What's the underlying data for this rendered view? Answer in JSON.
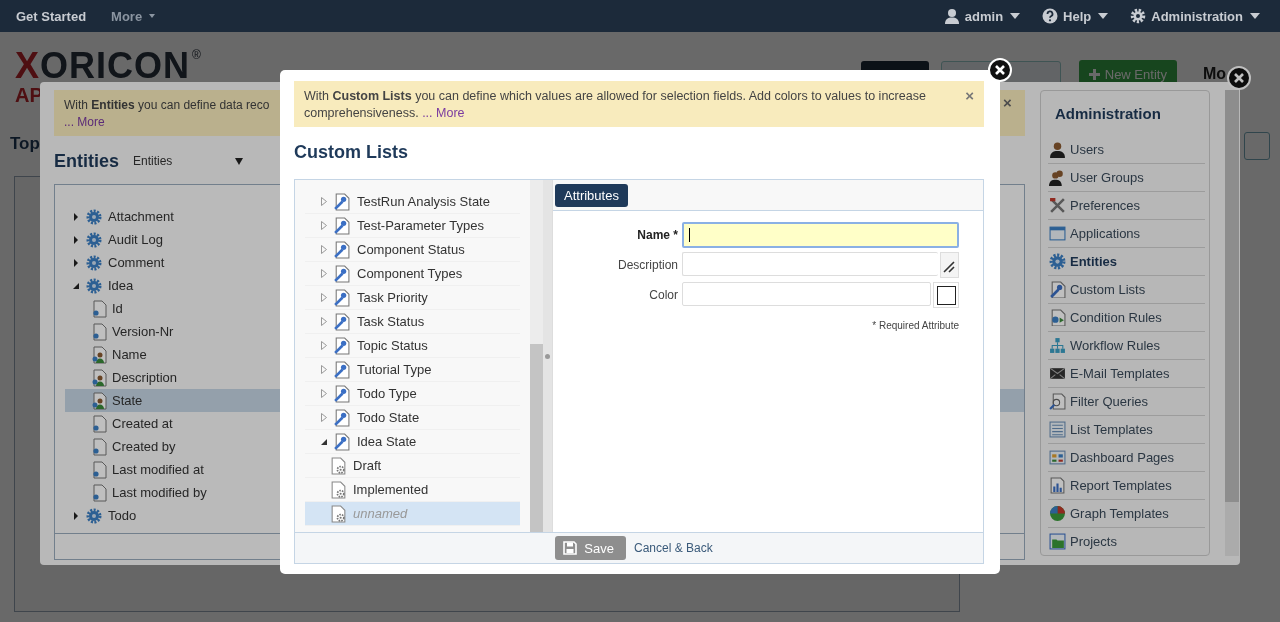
{
  "topbar": {
    "left": [
      {
        "label": "Get Started",
        "dropdown": false
      },
      {
        "label": "More",
        "dropdown": true
      }
    ],
    "right": [
      {
        "label": "admin",
        "dropdown": true
      },
      {
        "label": "Help",
        "dropdown": true
      },
      {
        "label": "Administration",
        "dropdown": true
      }
    ]
  },
  "page": {
    "logo": "XORICON",
    "logo_mark": "®",
    "logo_sub": "AP",
    "heading": "Top",
    "new_button": "New Entity",
    "more_link": "Mo"
  },
  "entities_dialog": {
    "info": "With **Entities** you can define data reco",
    "info_more": "... More",
    "info_close": "×",
    "title": "Entities",
    "select": "Entities",
    "tree": [
      {
        "label": "Attachment",
        "expanded": false,
        "selected": false
      },
      {
        "label": "Audit Log",
        "expanded": false,
        "selected": false
      },
      {
        "label": "Comment",
        "expanded": false,
        "selected": false
      },
      {
        "label": "Idea",
        "expanded": true,
        "selected": false,
        "children": [
          {
            "label": "Id",
            "kind": "field",
            "selected": false
          },
          {
            "label": "Version-Nr",
            "kind": "field",
            "selected": false
          },
          {
            "label": "Name",
            "kind": "person",
            "selected": false
          },
          {
            "label": "Description",
            "kind": "person",
            "selected": false
          },
          {
            "label": "State",
            "kind": "person",
            "selected": true
          },
          {
            "label": "Created at",
            "kind": "field",
            "selected": false
          },
          {
            "label": "Created by",
            "kind": "field",
            "selected": false
          },
          {
            "label": "Last modified at",
            "kind": "field",
            "selected": false
          },
          {
            "label": "Last modified by",
            "kind": "field",
            "selected": false
          }
        ]
      },
      {
        "label": "Todo",
        "expanded": false,
        "selected": false
      }
    ],
    "admin": {
      "title": "Administration",
      "items": [
        {
          "label": "Users",
          "selected": false
        },
        {
          "label": "User Groups",
          "selected": false
        },
        {
          "label": "Preferences",
          "selected": false
        },
        {
          "label": "Applications",
          "selected": false
        },
        {
          "label": "Entities",
          "selected": true
        },
        {
          "label": "Custom Lists",
          "selected": false
        },
        {
          "label": "Condition Rules",
          "selected": false
        },
        {
          "label": "Workflow Rules",
          "selected": false
        },
        {
          "label": "E-Mail Templates",
          "selected": false
        },
        {
          "label": "Filter Queries",
          "selected": false
        },
        {
          "label": "List Templates",
          "selected": false
        },
        {
          "label": "Dashboard Pages",
          "selected": false
        },
        {
          "label": "Report Templates",
          "selected": false
        },
        {
          "label": "Graph Templates",
          "selected": false
        },
        {
          "label": "Projects",
          "selected": false
        }
      ]
    }
  },
  "custom_lists_dialog": {
    "info": "With **Custom Lists** you can define which values are allowed for selection fields. Add colors to values to increase comprehensiveness.",
    "info_more": "... More",
    "info_close": "×",
    "title": "Custom Lists",
    "tree": [
      {
        "label": "TestRun Analysis State",
        "expanded": false,
        "selected": false
      },
      {
        "label": "Test-Parameter Types",
        "expanded": false,
        "selected": false
      },
      {
        "label": "Component Status",
        "expanded": false,
        "selected": false
      },
      {
        "label": "Component Types",
        "expanded": false,
        "selected": false
      },
      {
        "label": "Task Priority",
        "expanded": false,
        "selected": false
      },
      {
        "label": "Task Status",
        "expanded": false,
        "selected": false
      },
      {
        "label": "Topic Status",
        "expanded": false,
        "selected": false
      },
      {
        "label": "Tutorial Type",
        "expanded": false,
        "selected": false
      },
      {
        "label": "Todo Type",
        "expanded": false,
        "selected": false
      },
      {
        "label": "Todo State",
        "expanded": false,
        "selected": false
      },
      {
        "label": "Idea State",
        "expanded": true,
        "selected": false,
        "children": [
          {
            "label": "Draft",
            "kind": "value",
            "selected": false
          },
          {
            "label": "Implemented",
            "kind": "value",
            "selected": false
          },
          {
            "label": "unnamed",
            "kind": "unnamed",
            "selected": true
          }
        ]
      }
    ],
    "tabs": [
      {
        "label": "Attributes",
        "selected": true
      }
    ],
    "fields": [
      {
        "label": "Name *",
        "kind": "text",
        "required": true,
        "focused": true
      },
      {
        "label": "Description",
        "kind": "textarea",
        "required": false,
        "focused": false
      },
      {
        "label": "Color",
        "kind": "color",
        "required": false,
        "focused": false
      }
    ],
    "note": "* Required Attribute",
    "save": {
      "label": "Save",
      "disabled": true
    },
    "cancel": "Cancel & Back"
  }
}
